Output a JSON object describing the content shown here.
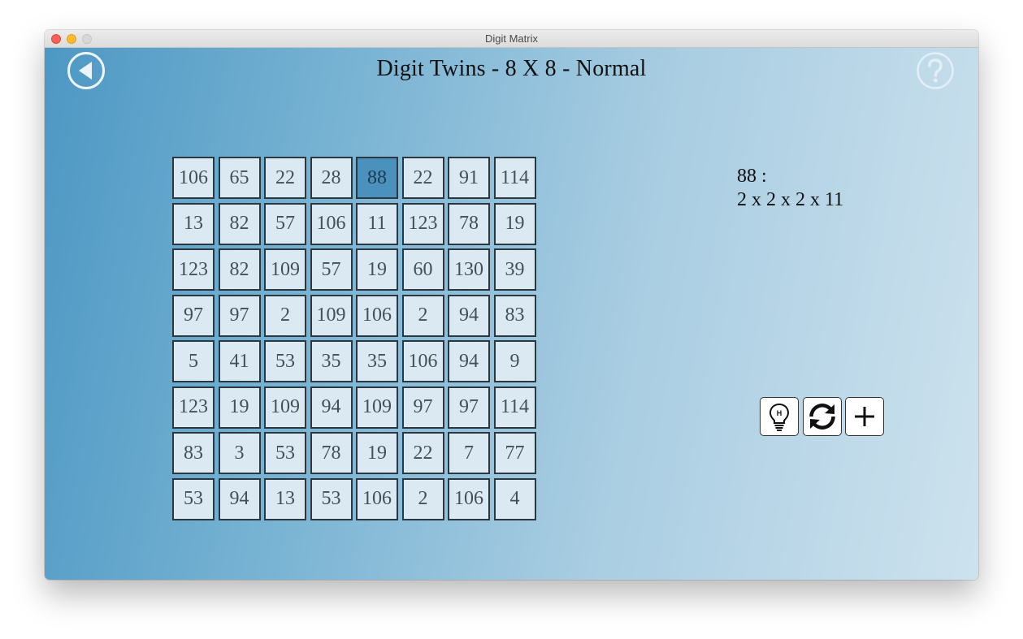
{
  "window": {
    "title": "Digit Matrix"
  },
  "header": {
    "title": "Digit Twins - 8 X 8 - Normal",
    "back_icon": "back-arrow-icon",
    "help_icon": "question-mark-icon"
  },
  "board": {
    "rows": [
      [
        "106",
        "65",
        "22",
        "28",
        "88",
        "22",
        "91",
        "114"
      ],
      [
        "13",
        "82",
        "57",
        "106",
        "11",
        "123",
        "78",
        "19"
      ],
      [
        "123",
        "82",
        "109",
        "57",
        "19",
        "60",
        "130",
        "39"
      ],
      [
        "97",
        "97",
        "2",
        "109",
        "106",
        "2",
        "94",
        "83"
      ],
      [
        "5",
        "41",
        "53",
        "35",
        "35",
        "106",
        "94",
        "9"
      ],
      [
        "123",
        "19",
        "109",
        "94",
        "109",
        "97",
        "97",
        "114"
      ],
      [
        "83",
        "3",
        "53",
        "78",
        "19",
        "22",
        "7",
        "77"
      ],
      [
        "53",
        "94",
        "13",
        "53",
        "106",
        "2",
        "106",
        "4"
      ]
    ],
    "selected": {
      "row": 0,
      "col": 4
    }
  },
  "factorization": {
    "number_line": "88 :",
    "factors_line": "2 x 2 x 2 x 11"
  },
  "toolbar": {
    "hint_icon": "lightbulb-hint-icon",
    "restart_icon": "refresh-icon",
    "new_game_icon": "plus-icon"
  },
  "colors": {
    "cell_background": "#dbe9f2",
    "cell_selected": "#4a92bd",
    "cell_border": "#2d3740",
    "background_start": "#4d98c4",
    "background_end": "#cde2ee"
  }
}
